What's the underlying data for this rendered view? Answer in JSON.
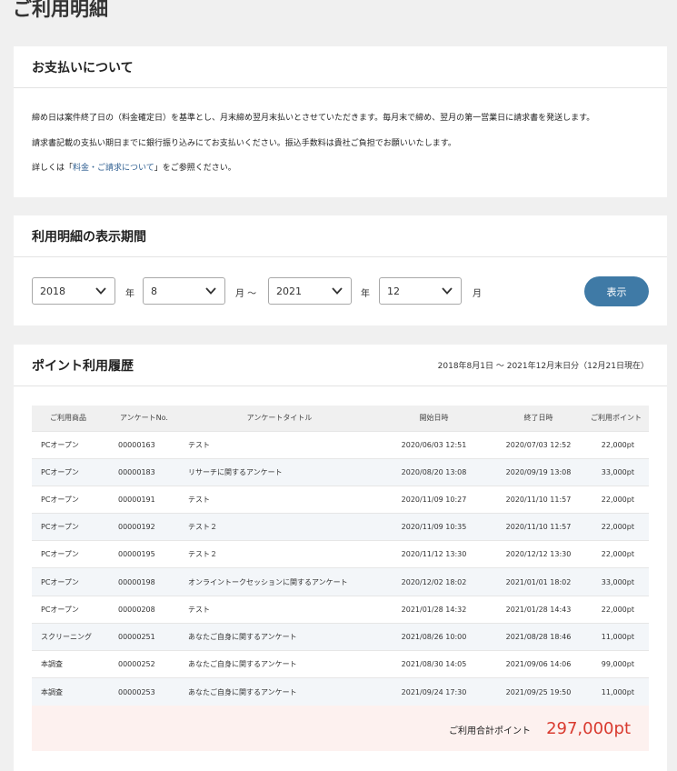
{
  "page_title": "ご利用明細",
  "payment": {
    "heading": "お支払いについて",
    "line1": "締め日は案件終了日の（料金確定日）を基準とし、月末締め翌月末払いとさせていただきます。毎月末で締め、翌月の第一営業日に請求書を発送します。",
    "line2": "請求書記載の支払い期日までに銀行振り込みにてお支払いください。振込手数料は貴社ご負担でお願いいたします。",
    "line3_prefix": "詳しくは「",
    "line3_link": "料金・ご請求について",
    "line3_suffix": "」をご参照ください。"
  },
  "period": {
    "heading": "利用明細の表示期間",
    "start_year": "2018",
    "start_month": "8",
    "end_year": "2021",
    "end_month": "12",
    "year_unit": "年",
    "month_unit_start": "月 ～",
    "month_unit_end": "月",
    "show_button": "表示"
  },
  "history": {
    "heading": "ポイント利用履歴",
    "range": "2018年8月1日 ～ 2021年12月末日分（12月21日現在）",
    "columns": [
      "ご利用商品",
      "アンケートNo.",
      "アンケートタイトル",
      "開始日時",
      "終了日時",
      "ご利用ポイント"
    ],
    "rows": [
      [
        "PCオープン",
        "00000163",
        "テスト",
        "2020/06/03 12:51",
        "2020/07/03 12:52",
        "22,000pt"
      ],
      [
        "PCオープン",
        "00000183",
        "リサーチに関するアンケート",
        "2020/08/20 13:08",
        "2020/09/19 13:08",
        "33,000pt"
      ],
      [
        "PCオープン",
        "00000191",
        "テスト",
        "2020/11/09 10:27",
        "2020/11/10 11:57",
        "22,000pt"
      ],
      [
        "PCオープン",
        "00000192",
        "テスト２",
        "2020/11/09 10:35",
        "2020/11/10 11:57",
        "22,000pt"
      ],
      [
        "PCオープン",
        "00000195",
        "テスト２",
        "2020/11/12 13:30",
        "2020/12/12 13:30",
        "22,000pt"
      ],
      [
        "PCオープン",
        "00000198",
        "オンライントークセッションに関するアンケート",
        "2020/12/02 18:02",
        "2021/01/01 18:02",
        "33,000pt"
      ],
      [
        "PCオープン",
        "00000208",
        "テスト",
        "2021/01/28 14:32",
        "2021/01/28 14:43",
        "22,000pt"
      ],
      [
        "スクリーニング",
        "00000251",
        "あなたご自身に関するアンケート",
        "2021/08/26 10:00",
        "2021/08/28 18:46",
        "11,000pt"
      ],
      [
        "本調査",
        "00000252",
        "あなたご自身に関するアンケート",
        "2021/08/30 14:05",
        "2021/09/06 14:06",
        "99,000pt"
      ],
      [
        "本調査",
        "00000253",
        "あなたご自身に関するアンケート",
        "2021/09/24 17:30",
        "2021/09/25 19:50",
        "11,000pt"
      ]
    ],
    "total_label": "ご利用合計ポイント",
    "total_value": "297,000pt"
  },
  "colors": {
    "accent": "#3f7aa6",
    "total": "#d93a2f",
    "link": "#2f5f91"
  }
}
